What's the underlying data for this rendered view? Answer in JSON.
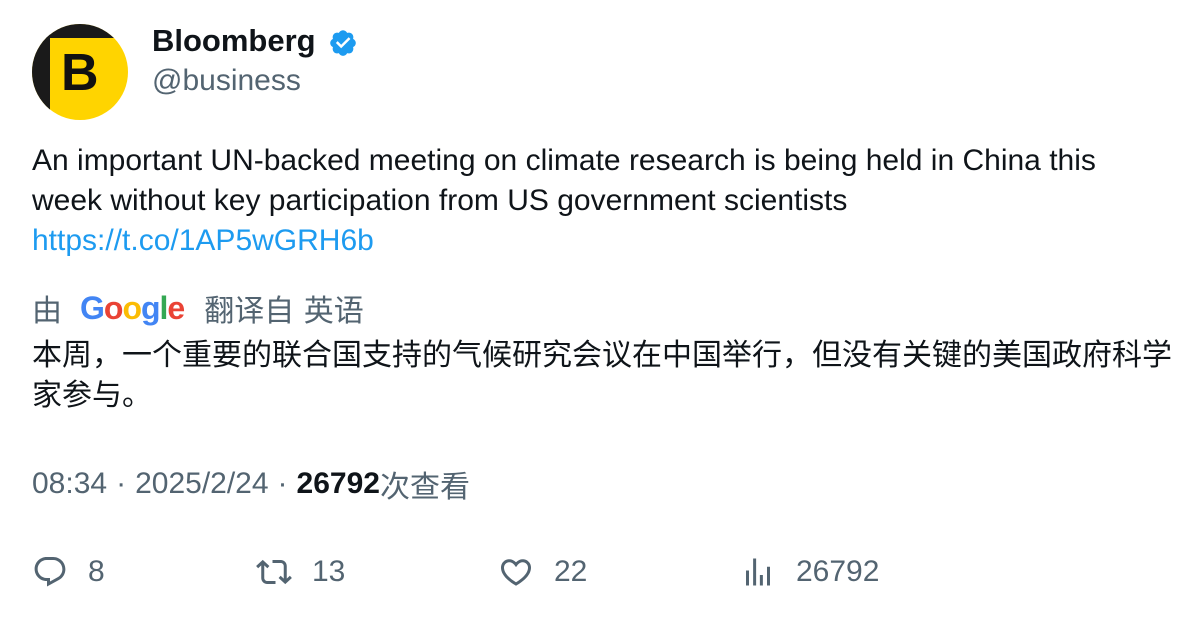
{
  "author": {
    "display_name": "Bloomberg",
    "handle": "@business",
    "avatar_letter": "B",
    "verified": true,
    "avatar_color": "#ffd400"
  },
  "tweet": {
    "text_line1": "An important UN-backed meeting on climate research is being held in China this week without key participation from US government scientists",
    "link": "https://t.co/1AP5wGRH6b"
  },
  "translation": {
    "by_label": "由",
    "provider_letters": [
      "G",
      "o",
      "o",
      "g",
      "l",
      "e"
    ],
    "translated_from_label": "翻译自 英语",
    "text": "本周，一个重要的联合国支持的气候研究会议在中国举行，但没有关键的美国政府科学家参与。"
  },
  "meta": {
    "time": "08:34",
    "separator": "·",
    "date": "2025/2/24",
    "views_count": "26792",
    "views_label": "次查看"
  },
  "actions": {
    "reply_count": "8",
    "retweet_count": "13",
    "like_count": "22",
    "views_count": "26792"
  },
  "colors": {
    "link": "#1d9bf0",
    "verified": "#1d9bf0",
    "secondary_text": "#536471",
    "primary_text": "#0f1419"
  }
}
